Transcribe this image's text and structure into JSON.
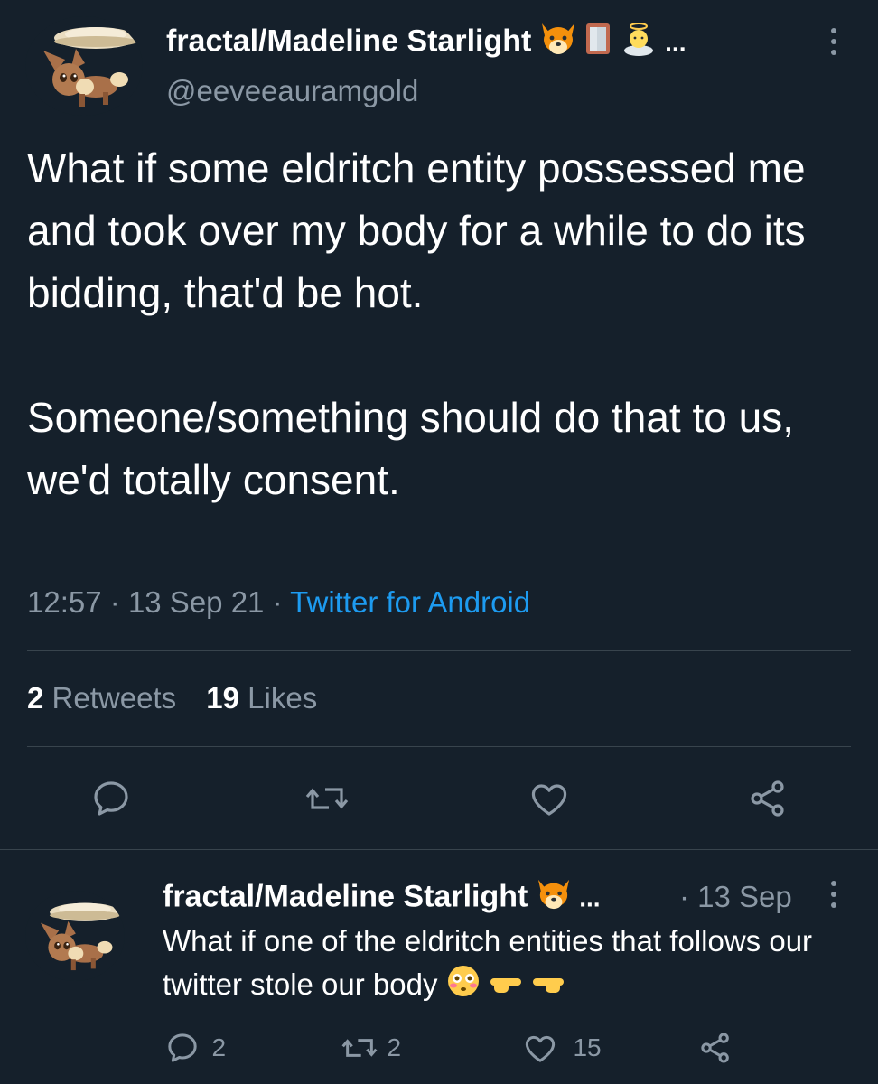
{
  "main_tweet": {
    "display_name": "fractal/Madeline Starlight",
    "name_emojis": [
      "fox-face",
      "mirror",
      "baby-angel"
    ],
    "name_overflow": "...",
    "handle": "@eeveeauramgold",
    "text": "What if some eldritch entity possessed me and took over my body for a while to do its bidding, that'd be hot.\n\nSomeone/something should do that to us, we'd totally consent.",
    "time": "12:57",
    "date": "13 Sep 21",
    "separator": "·",
    "source": "Twitter for Android",
    "retweets_count": "2",
    "retweets_label": "Retweets",
    "likes_count": "19",
    "likes_label": "Likes"
  },
  "reply_tweet": {
    "display_name": "fractal/Madeline Starlight",
    "name_overflow": "...",
    "date": "· 13 Sep",
    "text": "What if one of the eldritch entities that follows our twitter stole our body",
    "reply_count": "2",
    "retweet_count": "2",
    "like_count": "15"
  },
  "colors": {
    "background": "#15202b",
    "text_primary": "#ffffff",
    "text_secondary": "#8b98a5",
    "link": "#1d9bf0",
    "divider": "#38444d"
  }
}
